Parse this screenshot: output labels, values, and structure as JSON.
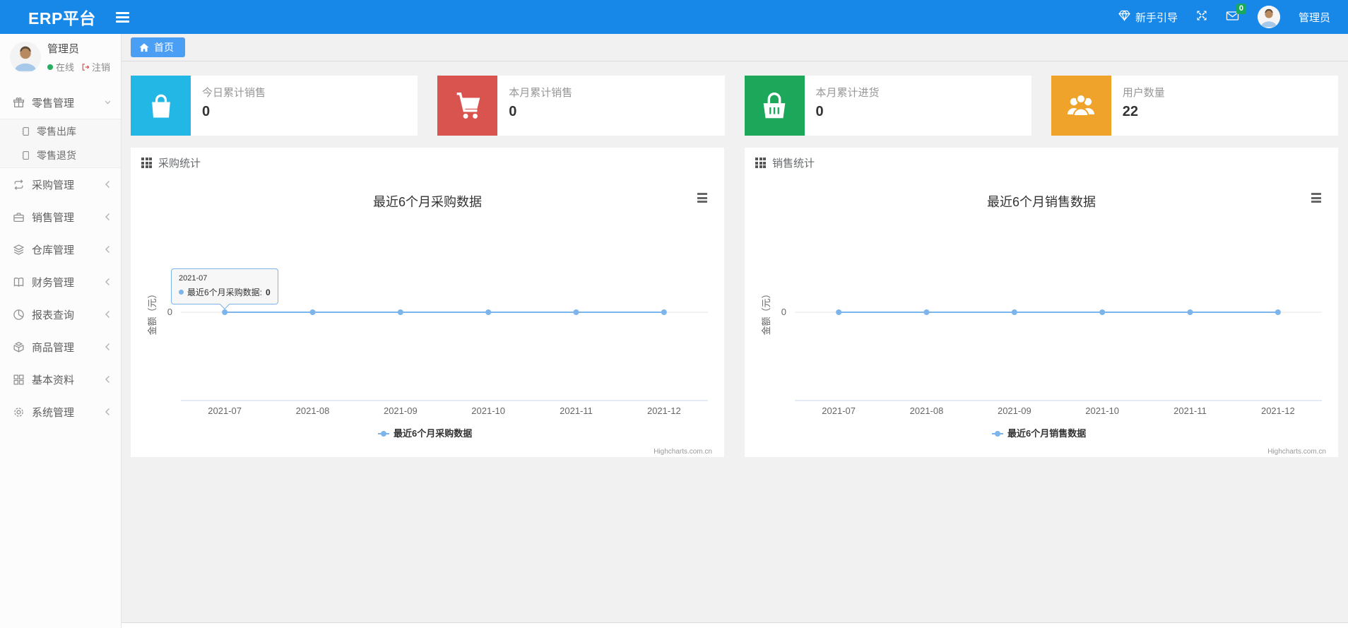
{
  "navbar": {
    "brand": "ERP平台",
    "guide_label": "新手引导",
    "mail_badge": "0",
    "user_name": "管理员",
    "icons": [
      "gem-icon",
      "expand-arrows-icon",
      "mail-icon",
      "avatar"
    ]
  },
  "sidebar": {
    "user": {
      "name": "管理员",
      "status": "在线",
      "logout": "注销"
    },
    "menu": [
      {
        "label": "零售管理",
        "icon": "gift-icon",
        "state": "expanded",
        "children": [
          {
            "label": "零售出库",
            "icon": "journal-icon"
          },
          {
            "label": "零售退货",
            "icon": "journal-icon"
          }
        ]
      },
      {
        "label": "采购管理",
        "icon": "repeat-icon",
        "state": "collapsed"
      },
      {
        "label": "销售管理",
        "icon": "briefcase-icon",
        "state": "collapsed"
      },
      {
        "label": "仓库管理",
        "icon": "layers-icon",
        "state": "collapsed"
      },
      {
        "label": "财务管理",
        "icon": "book-icon",
        "state": "collapsed"
      },
      {
        "label": "报表查询",
        "icon": "pie-chart-icon",
        "state": "collapsed"
      },
      {
        "label": "商品管理",
        "icon": "box-icon",
        "state": "collapsed"
      },
      {
        "label": "基本资料",
        "icon": "grid-icon",
        "state": "collapsed"
      },
      {
        "label": "系统管理",
        "icon": "gear-icon",
        "state": "collapsed"
      }
    ]
  },
  "tabs": [
    {
      "label": "首页",
      "icon": "home-icon",
      "active": true
    }
  ],
  "cards": [
    {
      "label": "今日累计销售",
      "value": "0",
      "color": "#23b7e5",
      "icon": "shopping-bag-icon"
    },
    {
      "label": "本月累计销售",
      "value": "0",
      "color": "#d9534f",
      "icon": "cart-icon"
    },
    {
      "label": "本月累计进货",
      "value": "0",
      "color": "#1da75a",
      "icon": "basket-icon"
    },
    {
      "label": "用户数量",
      "value": "22",
      "color": "#f0a32a",
      "icon": "users-icon"
    }
  ],
  "panels": [
    {
      "title": "采购统计"
    },
    {
      "title": "销售统计"
    }
  ],
  "chart_data": [
    {
      "type": "line",
      "title": "最近6个月采购数据",
      "categories": [
        "2021-07",
        "2021-08",
        "2021-09",
        "2021-10",
        "2021-11",
        "2021-12"
      ],
      "series": [
        {
          "name": "最近6个月采购数据",
          "values": [
            0,
            0,
            0,
            0,
            0,
            0
          ]
        }
      ],
      "ylabel": "金额（元）",
      "yticks": [
        "0"
      ],
      "color": "#7cb5ec",
      "grid": true,
      "legend_position": "bottom",
      "credits": "Highcharts.com.cn",
      "tooltip": {
        "header": "2021-07",
        "name": "最近6个月采购数据: ",
        "value": "0"
      }
    },
    {
      "type": "line",
      "title": "最近6个月销售数据",
      "categories": [
        "2021-07",
        "2021-08",
        "2021-09",
        "2021-10",
        "2021-11",
        "2021-12"
      ],
      "series": [
        {
          "name": "最近6个月销售数据",
          "values": [
            0,
            0,
            0,
            0,
            0,
            0
          ]
        }
      ],
      "ylabel": "金额（元）",
      "yticks": [
        "0"
      ],
      "color": "#7cb5ec",
      "grid": true,
      "legend_position": "bottom",
      "credits": "Highcharts.com.cn"
    }
  ]
}
